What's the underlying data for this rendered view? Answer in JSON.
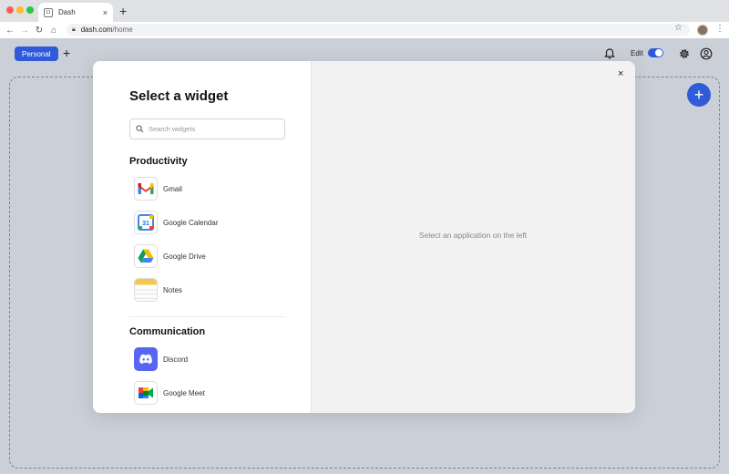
{
  "browser": {
    "tab_title": "Dash",
    "tab_favicon_text": "11",
    "tab_close": "×",
    "new_tab": "+",
    "url_host": "dash.com",
    "url_path": "/home",
    "icons": [
      "back-icon",
      "forward-icon",
      "reload-icon",
      "home-icon",
      "lock-icon",
      "star-icon",
      "profile-avatar",
      "kebab-menu-icon"
    ]
  },
  "header": {
    "space_button": "Personal",
    "add_space": "+",
    "edit_label": "Edit",
    "edit_enabled": true
  },
  "fab": {
    "label": "+"
  },
  "modal": {
    "title": "Select a widget",
    "search_placeholder": "Search widgets",
    "close": "×",
    "empty_message": "Select an application on the left",
    "sections": [
      {
        "title": "Productivity",
        "items": [
          {
            "label": "Gmail",
            "icon": "gmail-icon"
          },
          {
            "label": "Google Calendar",
            "icon": "google-calendar-icon",
            "icon_text": "31"
          },
          {
            "label": "Google Drive",
            "icon": "google-drive-icon"
          },
          {
            "label": "Notes",
            "icon": "notes-icon"
          }
        ]
      },
      {
        "title": "Communication",
        "items": [
          {
            "label": "Discord",
            "icon": "discord-icon"
          },
          {
            "label": "Google Meet",
            "icon": "google-meet-icon"
          }
        ]
      }
    ]
  },
  "colors": {
    "accent": "#2f5bd9",
    "page_bg": "#cbd0d8",
    "discord": "#5865f2"
  }
}
